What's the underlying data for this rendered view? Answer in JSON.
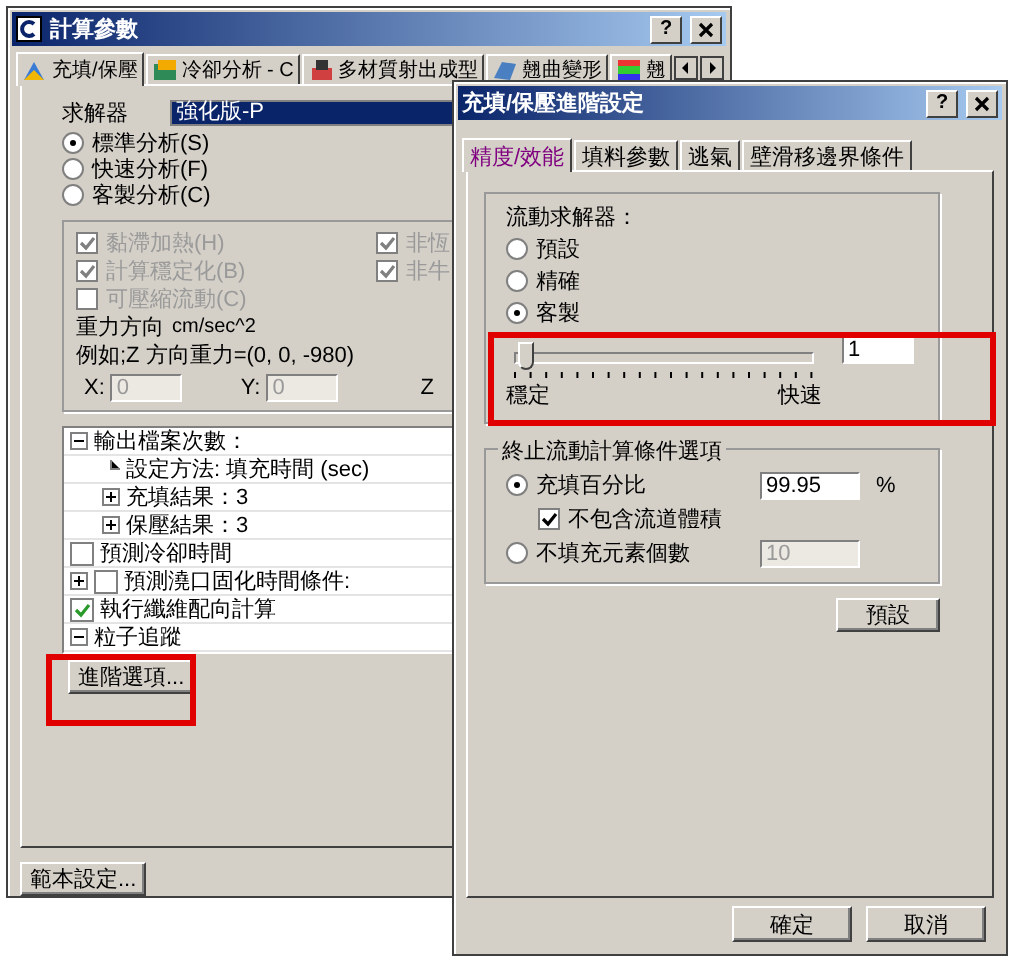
{
  "main_window": {
    "title": "計算參數",
    "help": "?",
    "tabs": [
      {
        "label": "充填/保壓",
        "selected": true
      },
      {
        "label": "冷卻分析 - C",
        "selected": false
      },
      {
        "label": "多材質射出成型",
        "selected": false
      },
      {
        "label": "翹曲變形",
        "selected": false
      },
      {
        "label": "翹",
        "selected": false
      }
    ],
    "solver": {
      "label": "求解器",
      "value": "強化版-P"
    },
    "modes": [
      {
        "label": "標準分析(S)",
        "selected": true
      },
      {
        "label": "快速分析(F)",
        "selected": false
      },
      {
        "label": "客製分析(C)",
        "selected": false
      }
    ],
    "options_left": [
      {
        "label": "黏滯加熱(H)",
        "checked": true,
        "disabled": true
      },
      {
        "label": "計算穩定化(B)",
        "checked": true,
        "disabled": true
      },
      {
        "label": "可壓縮流動(C)",
        "checked": false,
        "disabled": true
      }
    ],
    "options_right": [
      {
        "label": "非恆",
        "checked": true,
        "disabled": true
      },
      {
        "label": "非牛",
        "checked": true,
        "disabled": true
      }
    ],
    "gravity": {
      "label": "重力方向",
      "unit": "cm/sec^2",
      "example": "例如;Z 方向重力=(0, 0, -980)",
      "fields": [
        {
          "label": "X:",
          "value": "0"
        },
        {
          "label": "Y:",
          "value": "0"
        },
        {
          "label": "Z"
        }
      ]
    },
    "tree": [
      {
        "kind": "node",
        "label": "輸出檔案次數：",
        "expanded": true,
        "children": [
          {
            "kind": "leaf",
            "label": "設定方法: 填充時間 (sec)"
          },
          {
            "kind": "node",
            "label": "充填結果：3",
            "expanded": false
          },
          {
            "kind": "node",
            "label": "保壓結果：3",
            "expanded": false
          }
        ]
      },
      {
        "kind": "check",
        "label": "預測冷卻時間",
        "checked": false
      },
      {
        "kind": "node-check",
        "label": "預測澆口固化時間條件:",
        "expanded": false,
        "checked": false
      },
      {
        "kind": "check",
        "label": "執行纖維配向計算",
        "checked": true
      },
      {
        "kind": "node",
        "label": "粒子追蹤",
        "expanded": true
      }
    ],
    "advanced_button": "進階選項...",
    "template_button": "範本設定..."
  },
  "dialog": {
    "title": "充填/保壓進階設定",
    "help": "?",
    "tabs": [
      {
        "label": "精度/效能",
        "selected": true
      },
      {
        "label": "填料參數",
        "selected": false
      },
      {
        "label": "逃氣",
        "selected": false
      },
      {
        "label": "壁滑移邊界條件",
        "selected": false
      }
    ],
    "solver_group": {
      "title": "流動求解器：",
      "options": [
        {
          "label": "預設",
          "selected": false
        },
        {
          "label": "精確",
          "selected": false
        },
        {
          "label": "客製",
          "selected": true
        }
      ],
      "slider": {
        "level": 0.04,
        "min_label": "穩定",
        "max_label": "快速",
        "value": "1"
      }
    },
    "stop_group": {
      "title": "終止流動計算條件選項",
      "options": [
        {
          "label": "充填百分比",
          "selected": true,
          "value": "99.95",
          "unit": "%",
          "disabled": false,
          "sub_check": {
            "label": "不包含流道體積",
            "checked": true
          }
        },
        {
          "label": "不填充元素個數",
          "selected": false,
          "value": "10",
          "disabled": true
        }
      ]
    },
    "default_button": "預設",
    "buttons": [
      "確定",
      "取消"
    ]
  }
}
